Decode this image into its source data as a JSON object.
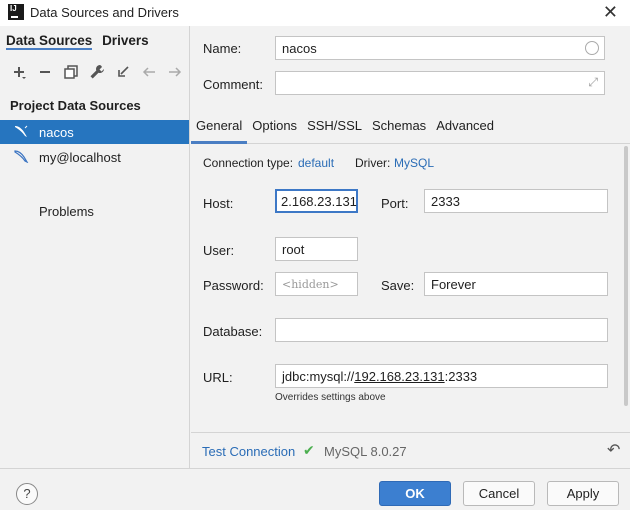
{
  "window": {
    "title": "Data Sources and Drivers",
    "app_icon": "IJ"
  },
  "left_panel": {
    "tabs": [
      "Data Sources",
      "Drivers"
    ],
    "toolbar_icons": [
      "add-icon",
      "remove-icon",
      "duplicate-icon",
      "wrench-icon",
      "import-icon",
      "back-arrow-icon",
      "forward-arrow-icon"
    ],
    "section_title": "Project Data Sources",
    "items": [
      {
        "label": "nacos",
        "selected": true
      },
      {
        "label": "my@localhost",
        "selected": false
      }
    ],
    "problems_label": "Problems"
  },
  "form": {
    "name_label": "Name:",
    "name_value": "nacos",
    "comment_label": "Comment:",
    "comment_value": "",
    "tabs": [
      "General",
      "Options",
      "SSH/SSL",
      "Schemas",
      "Advanced"
    ],
    "connection_type_label": "Connection type:",
    "connection_type_value": "default",
    "driver_label": "Driver:",
    "driver_value": "MySQL",
    "host_label": "Host:",
    "host_value": "2.168.23.131",
    "port_label": "Port:",
    "port_value": "2333",
    "user_label": "User:",
    "user_value": "root",
    "password_label": "Password:",
    "password_placeholder": "<hidden>",
    "save_label": "Save:",
    "save_value": "Forever",
    "database_label": "Database:",
    "database_value": "",
    "url_label": "URL:",
    "url_prefix": "jdbc:mysql://",
    "url_host": "192.168.23.131",
    "url_suffix": ":2333",
    "url_hint": "Overrides settings above"
  },
  "test": {
    "link_label": "Test Connection",
    "status": "MySQL 8.0.27"
  },
  "buttons": {
    "help": "?",
    "ok": "OK",
    "cancel": "Cancel",
    "apply": "Apply"
  },
  "colors": {
    "accent": "#2675bf",
    "link": "#2a6cb6",
    "primary_button": "#3c7fd0",
    "success_check": "#4caf50"
  }
}
